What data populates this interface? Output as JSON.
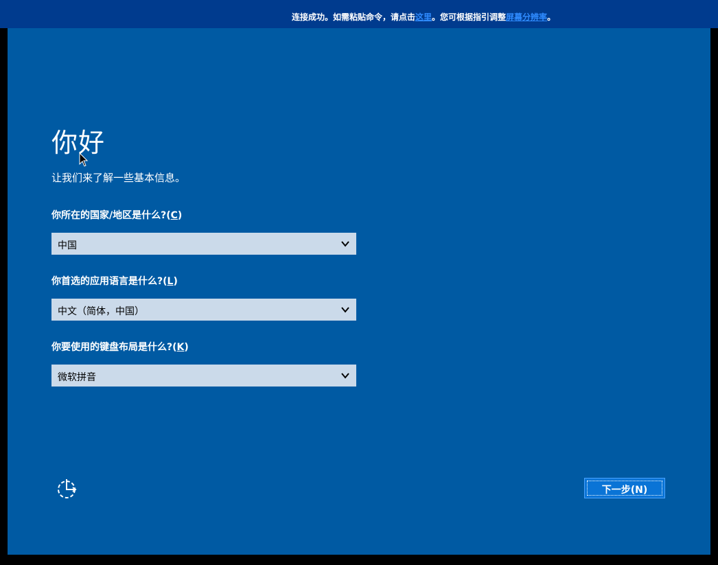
{
  "banner": {
    "prefix": "连接成功。如需粘贴命令，请点击",
    "link1": "这里",
    "middle": "。您可根据指引调整",
    "link2": "屏幕分辨率",
    "suffix": "。"
  },
  "setup": {
    "title": "你好",
    "subtitle": "让我们来了解一些基本信息。",
    "country": {
      "question": "你所在的国家/地区是什么?(",
      "accel": "C",
      "close": ")",
      "value": "中国"
    },
    "language": {
      "question": "你首选的应用语言是什么?(",
      "accel": "L",
      "close": ")",
      "value": "中文（简体，中国）"
    },
    "keyboard": {
      "question": "你要使用的键盘布局是什么?(",
      "accel": "K",
      "close": ")",
      "value": "微软拼音"
    },
    "next_label": "下一步(N)"
  },
  "colors": {
    "background": "#005aa3",
    "banner": "#003b8e",
    "dropdown": "#cbdaea",
    "button": "#0a74d6",
    "link": "#2f8bff"
  },
  "icons": {
    "dropdown": "chevron-down-icon",
    "accessibility": "ease-of-access-icon",
    "pointer": "mouse-pointer-icon"
  }
}
